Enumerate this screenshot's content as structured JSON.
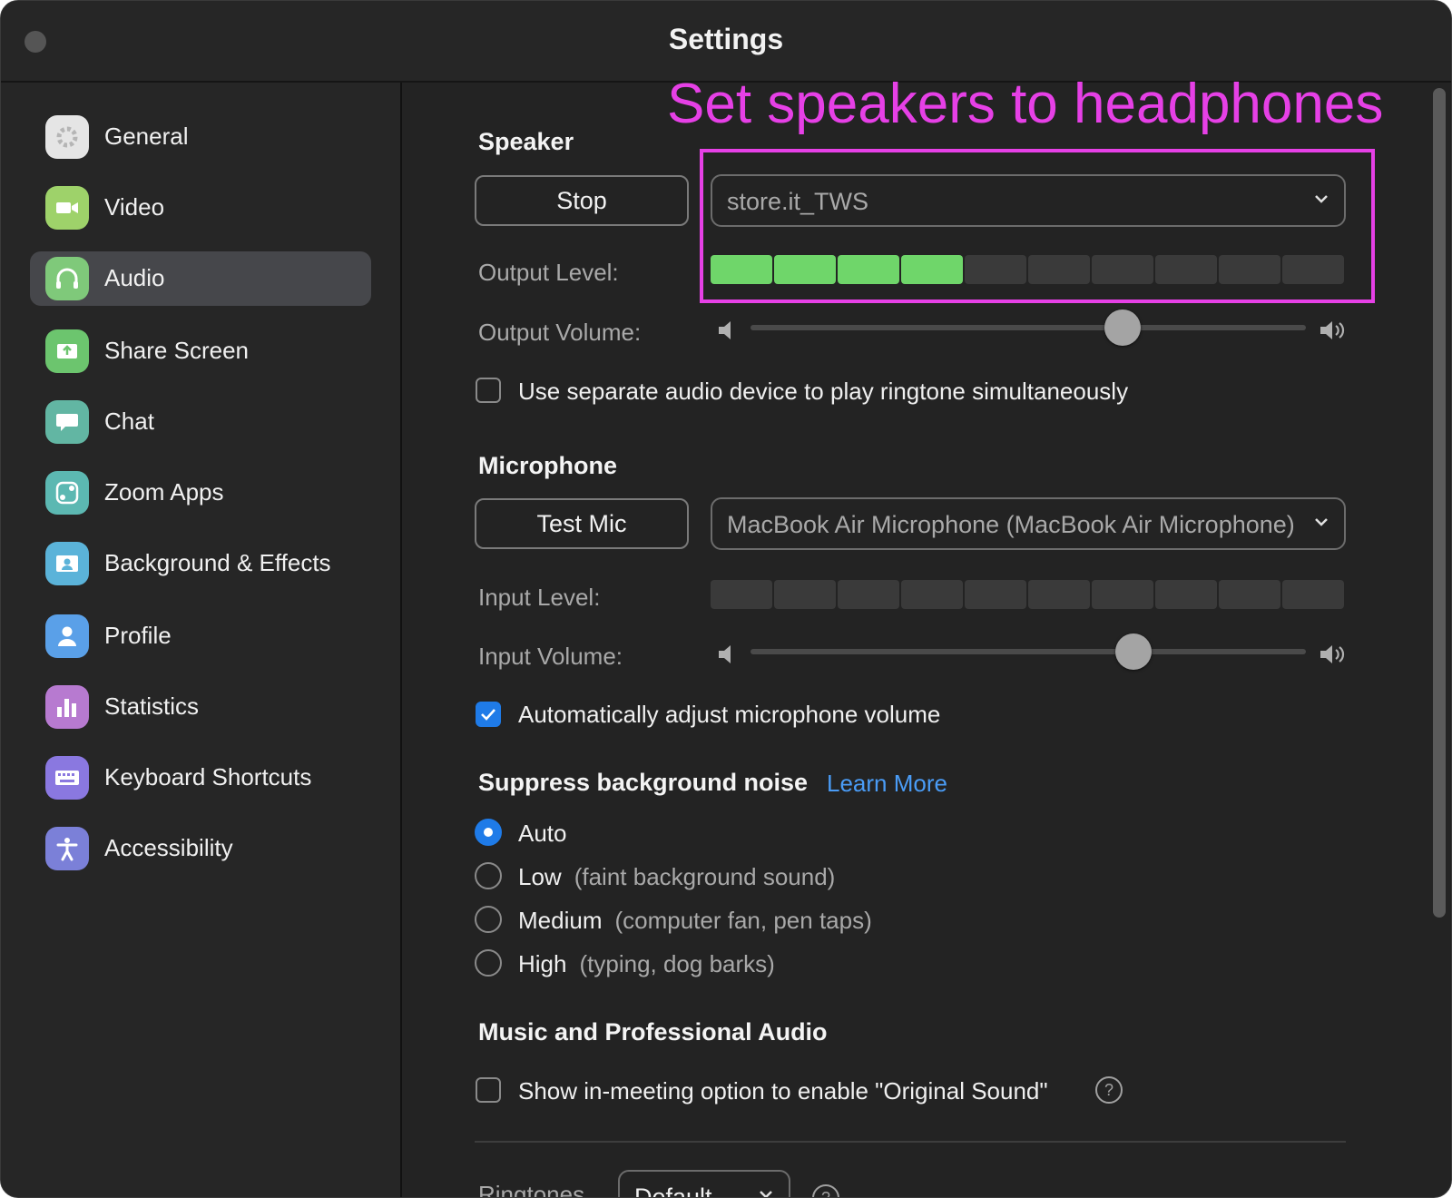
{
  "window": {
    "title": "Settings"
  },
  "sidebar": {
    "items": [
      {
        "label": "General",
        "icon": "gear-icon",
        "color": "#e5e5e5"
      },
      {
        "label": "Video",
        "icon": "video-camera-icon",
        "color": "#9ed26a"
      },
      {
        "label": "Audio",
        "icon": "headphones-icon",
        "color": "#7fc97a",
        "active": true
      },
      {
        "label": "Share Screen",
        "icon": "share-screen-icon",
        "color": "#6cc56e"
      },
      {
        "label": "Chat",
        "icon": "chat-bubble-icon",
        "color": "#62b6a3"
      },
      {
        "label": "Zoom Apps",
        "icon": "zoom-apps-icon",
        "color": "#5cb8b2"
      },
      {
        "label": "Background & Effects",
        "icon": "background-icon",
        "color": "#5bb3d9"
      },
      {
        "label": "Profile",
        "icon": "profile-icon",
        "color": "#5aa0e8"
      },
      {
        "label": "Statistics",
        "icon": "statistics-icon",
        "color": "#b77ad0"
      },
      {
        "label": "Keyboard Shortcuts",
        "icon": "keyboard-icon",
        "color": "#8a78e0"
      },
      {
        "label": "Accessibility",
        "icon": "accessibility-icon",
        "color": "#7b80d8"
      }
    ]
  },
  "annotation": {
    "text": "Set speakers to headphones",
    "color": "#e640e6"
  },
  "speaker": {
    "title": "Speaker",
    "stop_label": "Stop",
    "device": "store.it_TWS",
    "output_level_label": "Output Level:",
    "output_level_segments_on": 4,
    "output_level_segments_total": 10,
    "output_volume_label": "Output Volume:",
    "output_volume_fraction": 0.67,
    "separate_device_label": "Use separate audio device to play ringtone simultaneously",
    "separate_device_checked": false
  },
  "microphone": {
    "title": "Microphone",
    "test_label": "Test Mic",
    "device": "MacBook Air Microphone (MacBook Air Microphone)",
    "input_level_label": "Input Level:",
    "input_level_segments_on": 0,
    "input_volume_label": "Input Volume:",
    "input_volume_fraction": 0.69,
    "auto_adjust_label": "Automatically adjust microphone volume",
    "auto_adjust_checked": true
  },
  "noise": {
    "title": "Suppress background noise",
    "learn_more": "Learn More",
    "options": [
      {
        "label": "Auto",
        "desc": "",
        "selected": true
      },
      {
        "label": "Low",
        "desc": "(faint background sound)",
        "selected": false
      },
      {
        "label": "Medium",
        "desc": "(computer fan, pen taps)",
        "selected": false
      },
      {
        "label": "High",
        "desc": "(typing, dog barks)",
        "selected": false
      }
    ]
  },
  "music": {
    "title": "Music and Professional Audio",
    "original_sound_label": "Show in-meeting option to enable \"Original Sound\"",
    "original_sound_checked": false,
    "help_glyph": "?"
  },
  "ringtones": {
    "label": "Ringtones",
    "value": "Default",
    "help_glyph": "?"
  },
  "colors": {
    "accent": "#1f7be8",
    "level_on": "#6fd66a",
    "link": "#4a9cf6"
  }
}
